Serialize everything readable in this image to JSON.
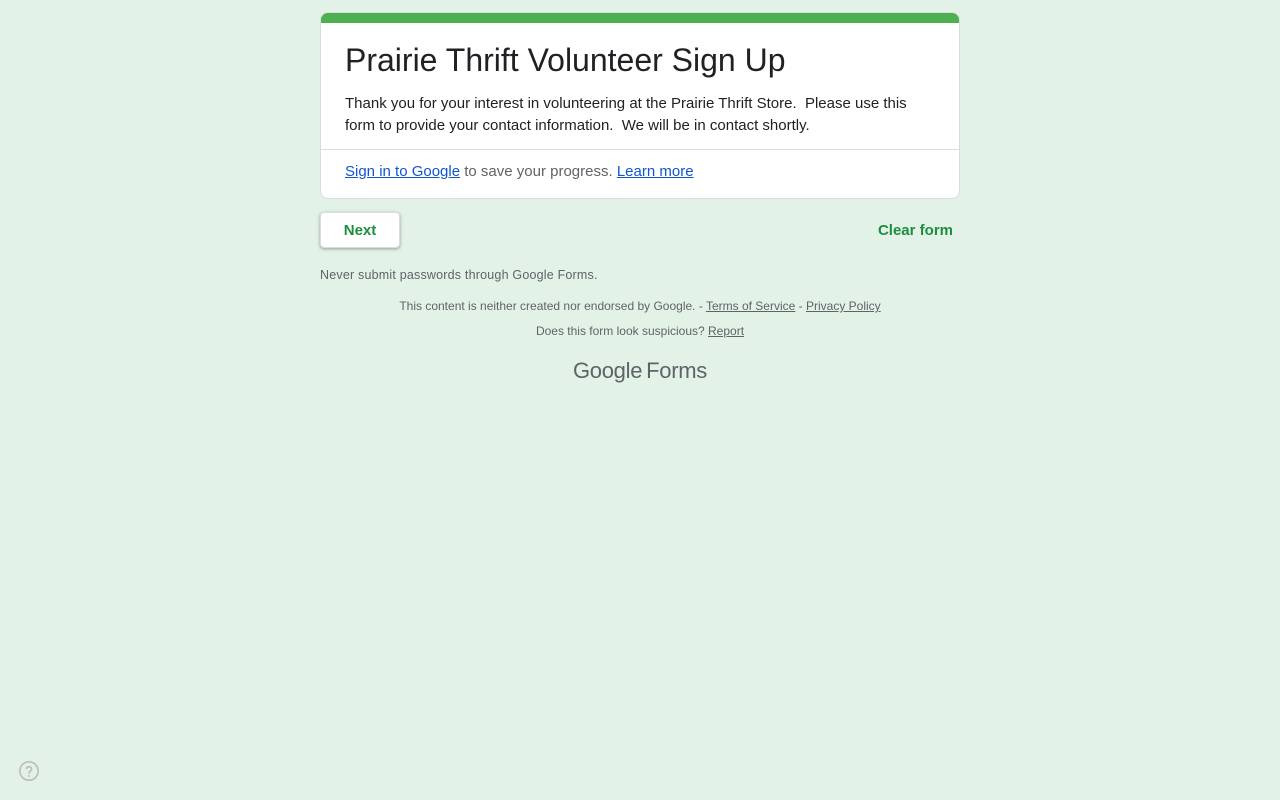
{
  "form": {
    "title": "Prairie Thrift Volunteer Sign Up",
    "description": "Thank you for your interest in volunteering at the Prairie Thrift Store.  Please use this form to provide your contact information.  We will be in contact shortly.",
    "accent_color": "#4caf50"
  },
  "signin": {
    "link_label": "Sign in to Google",
    "middle_text": " to save your progress. ",
    "learn_more_label": "Learn more"
  },
  "actions": {
    "next_label": "Next",
    "clear_label": "Clear form"
  },
  "notices": {
    "never_submit": "Never submit passwords through Google Forms.",
    "disclaimer": "This content is neither created nor endorsed by Google. - ",
    "terms_label": "Terms of Service",
    "separator": " - ",
    "privacy_label": "Privacy Policy",
    "suspicious_text": "Does this form look suspicious? ",
    "report_label": "Report"
  },
  "brand": {
    "google": "Google",
    "forms": "Forms"
  },
  "help": {
    "icon": "help-circle-icon"
  }
}
